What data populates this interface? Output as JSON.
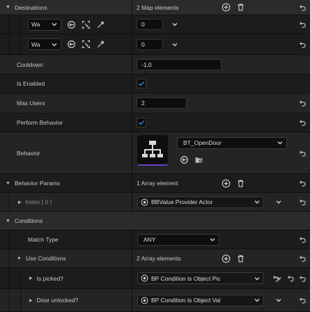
{
  "destinations": {
    "label": "Destinations",
    "count_text": "2 Map elements",
    "entries": [
      {
        "key_label": "Wa",
        "value": "0"
      },
      {
        "key_label": "Wa",
        "value": "0"
      }
    ]
  },
  "cooldown": {
    "label": "Cooldown",
    "value": "-1,0"
  },
  "is_enabled": {
    "label": "Is Enabled",
    "checked": true
  },
  "max_users": {
    "label": "Max Users",
    "value": "2"
  },
  "perform_behavior": {
    "label": "Perform Behavior",
    "checked": true
  },
  "behavior": {
    "label": "Behavior",
    "asset": "BT_OpenDoor"
  },
  "behavior_params": {
    "label": "Behavior Params",
    "count_text": "1 Array element",
    "index_label": "Index [ 0 ]",
    "index_value": "BBValue Provider Actor"
  },
  "conditions": {
    "label": "Conditions",
    "match_type": {
      "label": "Match Type",
      "value": "ANY"
    },
    "use_conditions": {
      "label": "Use Conditions",
      "count_text": "2 Array elements",
      "items": [
        {
          "label": "Is picked?",
          "value": "BP Condition Is Object Pic"
        },
        {
          "label": "Door unlocked?",
          "value": "BP Condition Is Object Val"
        }
      ]
    }
  },
  "colors": {
    "accent_purple": "#6f42c1",
    "check_blue": "#2f7fd6",
    "text": "#c8c8c8"
  }
}
